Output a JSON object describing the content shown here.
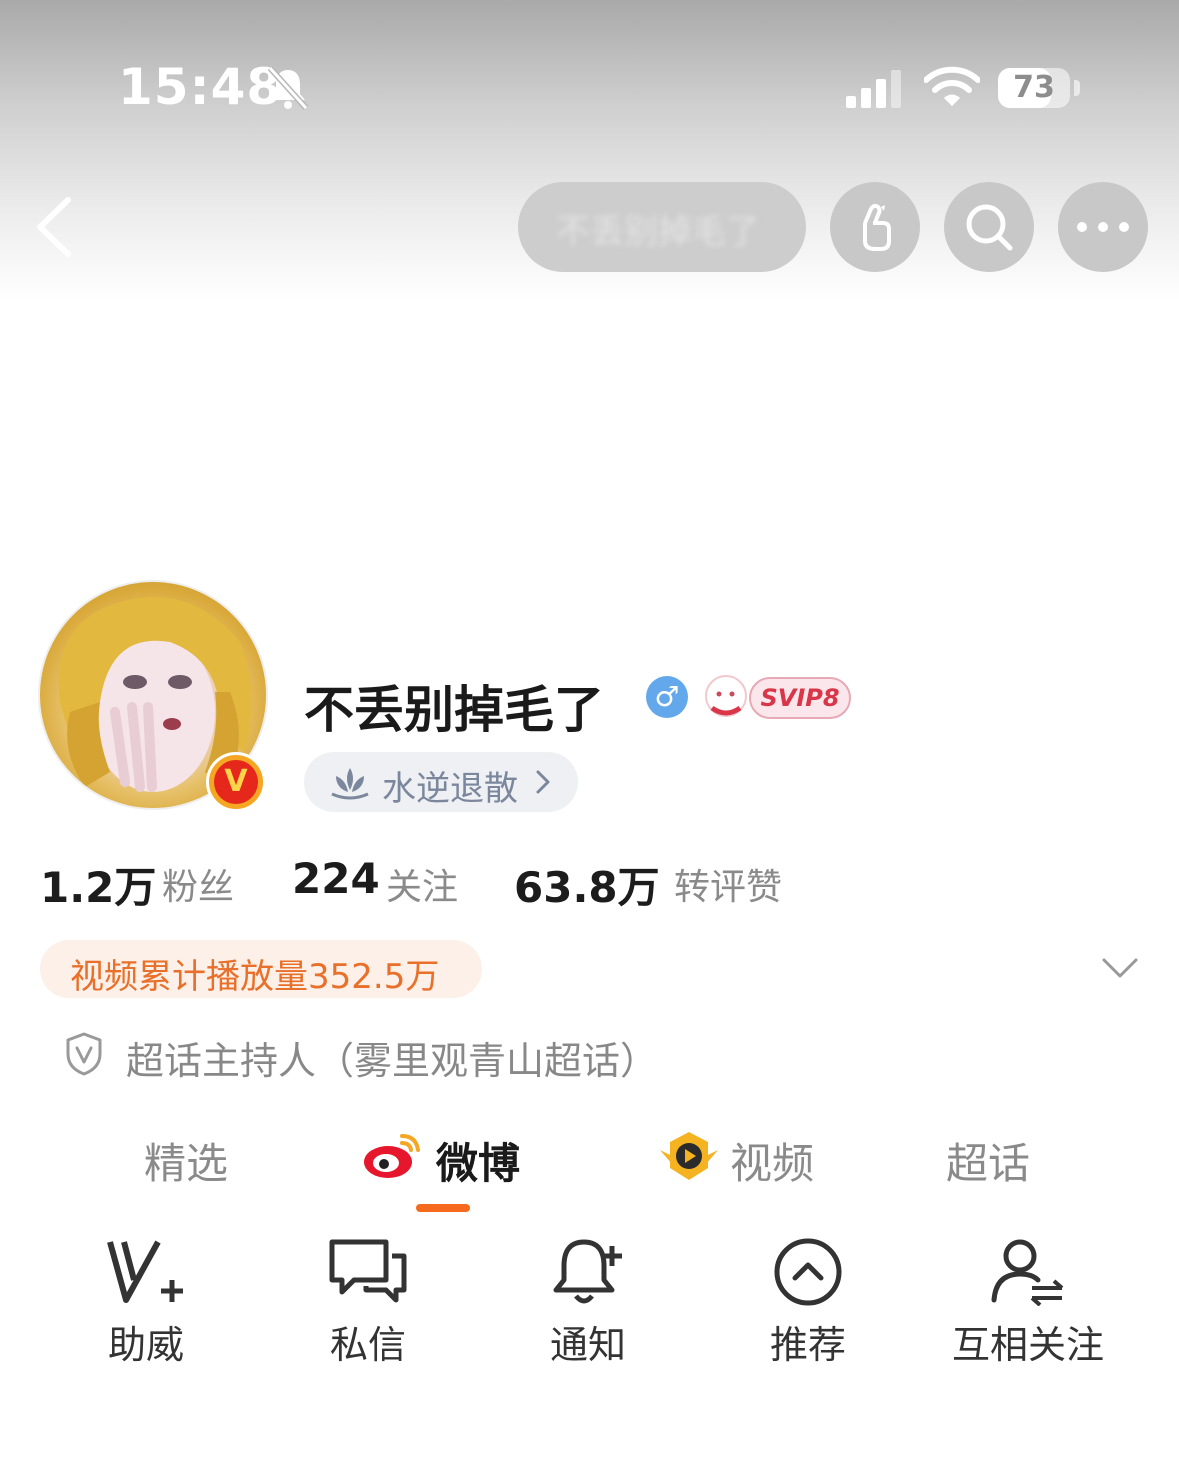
{
  "status_bar": {
    "time": "15:48",
    "battery": "73"
  },
  "nav": {
    "name_pill_text": "不丢别掉毛了"
  },
  "profile": {
    "username": "不丢别掉毛了",
    "gender_symbol": "♂",
    "svip_text": "SVIP8",
    "verified_badge": "V",
    "title_text": "水逆退散"
  },
  "stats": {
    "followers_num": "1.2万",
    "followers_label": "粉丝",
    "following_num": "224",
    "following_label": "关注",
    "likes_num": "63.8万",
    "likes_label": "转评赞"
  },
  "video_views": "视频累计播放量352.5万",
  "host_info": "超话主持人（雾里观青山超话）",
  "tabs": [
    {
      "label": "精选"
    },
    {
      "label": "微博"
    },
    {
      "label": "视频"
    },
    {
      "label": "超话"
    }
  ],
  "actions": [
    {
      "label": "助威"
    },
    {
      "label": "私信"
    },
    {
      "label": "通知"
    },
    {
      "label": "推荐"
    },
    {
      "label": "互相关注"
    }
  ],
  "colors": {
    "accent": "#f56a1c",
    "gender": "#62a8ea",
    "video_text": "#e8702a"
  }
}
